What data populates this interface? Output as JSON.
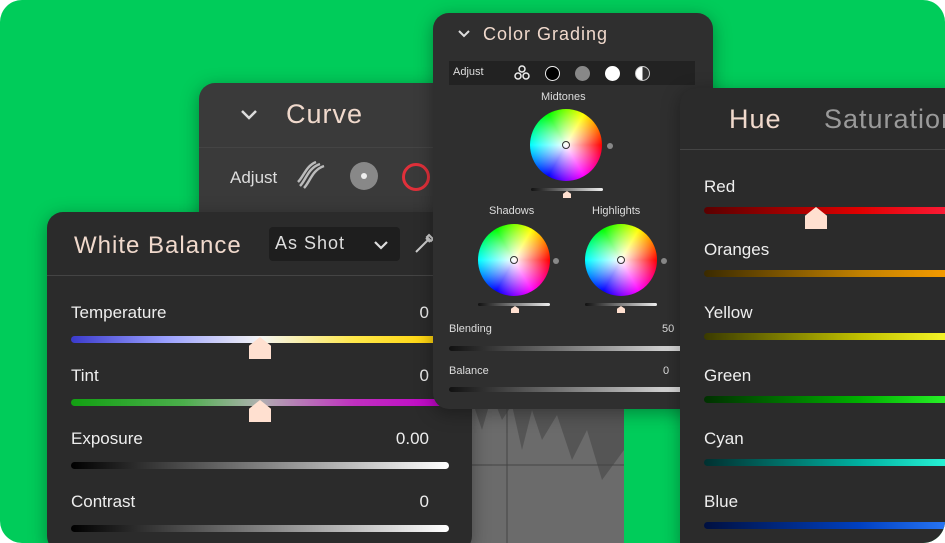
{
  "curve_panel": {
    "title": "Curve",
    "adjust_label": "Adjust"
  },
  "white_balance": {
    "title": "White Balance",
    "preset_value": "As Shot",
    "sliders": [
      {
        "label": "Temperature",
        "value": "0",
        "level": 0.5
      },
      {
        "label": "Tint",
        "value": "0",
        "level": 0.5
      },
      {
        "label": "Exposure",
        "value": "0.00"
      },
      {
        "label": "Contrast",
        "value": "0"
      }
    ]
  },
  "color_grading": {
    "title": "Color Grading",
    "adjust_label": "Adjust",
    "midtones_label": "Midtones",
    "shadows_label": "Shadows",
    "highlights_label": "Highlights",
    "blending_label": "Blending",
    "blending_value": "50",
    "balance_label": "Balance",
    "balance_value": "0"
  },
  "hue_panel": {
    "tabs": [
      "Hue",
      "Saturation"
    ],
    "colors": [
      {
        "label": "Red",
        "level": 0.45
      },
      {
        "label": "Oranges"
      },
      {
        "label": "Yellow"
      },
      {
        "label": "Green"
      },
      {
        "label": "Cyan"
      },
      {
        "label": "Blue"
      }
    ]
  },
  "colors": {
    "background": "#00cc5a",
    "panel": "#2b2b2b",
    "accent": "#f0d9cc"
  }
}
